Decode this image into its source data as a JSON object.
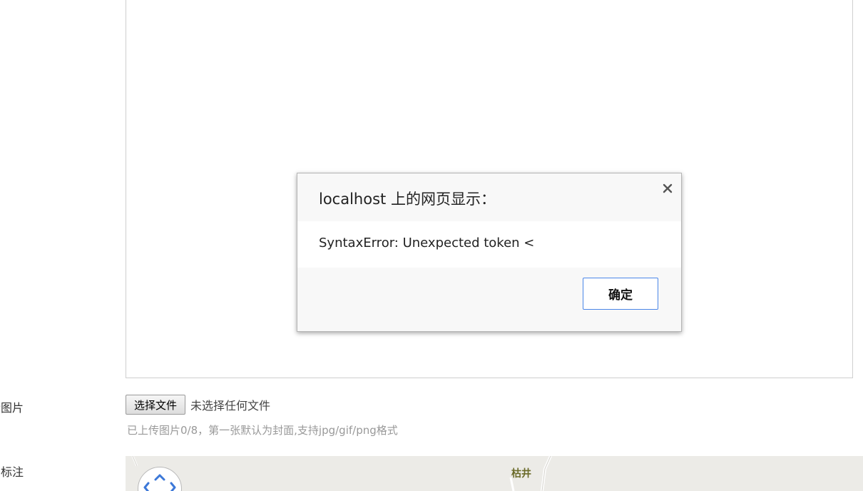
{
  "form": {
    "upload_label": "传图片",
    "map_label": "图标注",
    "file_button_label": "选择文件",
    "file_status": "未选择任何文件",
    "upload_hint": "已上传图片0/8，第一张默认为封面,支持jpg/gif/png格式"
  },
  "map": {
    "place_name": "枯井",
    "background_color": "#ecebe7"
  },
  "dialog": {
    "title": "localhost 上的网页显示：",
    "message": "SyntaxError: Unexpected token <",
    "ok_label": "确定",
    "close_icon": "close-icon",
    "accent_color": "#4a86e8"
  }
}
